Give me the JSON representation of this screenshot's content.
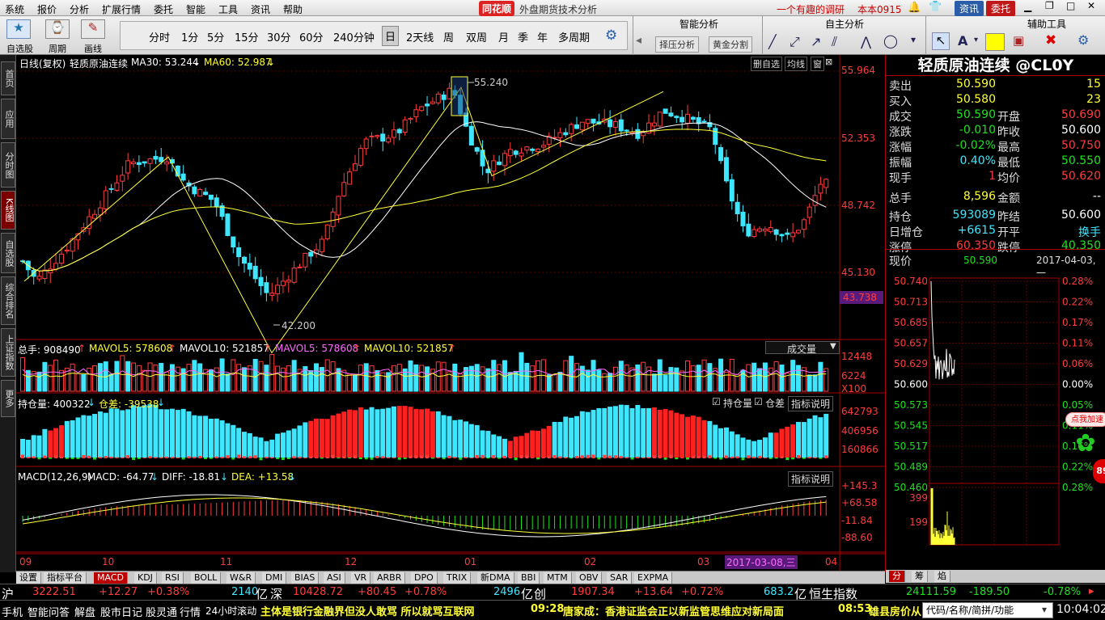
{
  "menu": {
    "items": [
      "系统",
      "报价",
      "分析",
      "扩展行情",
      "委托",
      "智能",
      "工具",
      "资讯",
      "帮助"
    ],
    "brand": "同花顺",
    "app_title": "外盘期货技术分析",
    "news_link": "一个有趣的调研",
    "user": "本本0915",
    "btn_zixun": "资讯",
    "btn_weituo": "委托"
  },
  "toolbar": {
    "tool_labels": [
      "自选股",
      "周期",
      "画线"
    ],
    "periods": [
      "分时",
      "1分",
      "5分",
      "15分",
      "30分",
      "60分",
      "240分钟",
      "日",
      "2天线",
      "周",
      "双周",
      "月",
      "季",
      "年",
      "多周期"
    ],
    "active_period": "日",
    "section_smart": "智能分析",
    "btn_select_analysis": "择压分析",
    "btn_gold_split": "黄金分割",
    "section_autonomous": "自主分析",
    "section_aux": "辅助工具"
  },
  "left_tabs": [
    "首页",
    "应用",
    "分时图",
    "K线图",
    "自选股",
    "综合排名",
    "上证指数",
    "更多"
  ],
  "left_active": "K线图",
  "main_chart": {
    "header": {
      "mode": "日线(复权)",
      "name": "轻质原油连续",
      "ma30_label": "MA30: 53.244",
      "ma60_label": "MA60: 52.987",
      "btn_delete": "删自选",
      "btn_avg": "均线",
      "btn_window": "窗"
    },
    "y_ticks": [
      "55.964",
      "52.353",
      "48.742",
      "45.130"
    ],
    "current_price_tag": "43.738",
    "high_label": "55.240",
    "low_label": "42.200",
    "x_ticks": [
      "09",
      "10",
      "11",
      "12",
      "01",
      "02",
      "03",
      "04"
    ],
    "cursor_date": "2017-03-08,三",
    "colors": {
      "up": "#ff3c3c",
      "down": "#3fe6ff",
      "ma_white": "#ffffff",
      "ma_yellow": "#ffff37",
      "zigzag": "#ffff37"
    }
  },
  "volume_panel": {
    "total_label": "总手: 908490",
    "mavol5_label": "MAVOL5: 578608",
    "mavol10_label": "MAVOL10: 521857",
    "mavol5b_label": "MAVOL5: 578608",
    "mavol10b_label": "MAVOL10: 521857",
    "dropdown": "成交量",
    "y_ticks": [
      "12448",
      "6224",
      "X100"
    ]
  },
  "oi_panel": {
    "oi_label": "持仓量: 400322",
    "diff_label": "仓差: -39538",
    "check_oi": "持仓量",
    "check_diff": "仓差",
    "btn_help": "指标说明",
    "y_ticks": [
      "642793",
      "406956",
      "160866"
    ]
  },
  "macd_panel": {
    "label": "MACD(12,26,9)",
    "macd_label": "MACD: -64.77",
    "diff_label": "DIFF: -18.81",
    "dea_label": "DEA: +13.58",
    "btn_help": "指标说明",
    "y_ticks": [
      "+145.3",
      "+68.58",
      "-11.84",
      "-88.60"
    ]
  },
  "bottom_tabs": [
    "设置",
    "指标平台",
    "MACD",
    "KDJ",
    "RSI",
    "BOLL",
    "W&R",
    "DMI",
    "BIAS",
    "ASI",
    "VR",
    "ARBR",
    "DPO",
    "TRIX",
    "新DMA",
    "BBI",
    "MTM",
    "OBV",
    "SAR",
    "EXPMA"
  ],
  "bottom_active": "MACD",
  "quote": {
    "title": "轻质原油连续 @CL0Y",
    "rows": [
      {
        "l": "卖出",
        "v": "50.590",
        "v_color": "#ffff37",
        "r": "",
        "rv": "15",
        "rv_color": "#ffff37"
      },
      {
        "l": "买入",
        "v": "50.580",
        "v_color": "#ffff37",
        "r": "",
        "rv": "23",
        "rv_color": "#ffff37"
      },
      {
        "l": "成交",
        "v": "50.590",
        "v_color": "#1ee21e",
        "r": "开盘",
        "rv": "50.690",
        "rv_color": "#ff3c3c"
      },
      {
        "l": "涨跌",
        "v": "-0.010",
        "v_color": "#1ee21e",
        "r": "昨收",
        "rv": "50.600",
        "rv_color": "#ffffff"
      },
      {
        "l": "涨幅",
        "v": "-0.02%",
        "v_color": "#1ee21e",
        "r": "最高",
        "rv": "50.750",
        "rv_color": "#ff3c3c"
      },
      {
        "l": "振幅",
        "v": "0.40%",
        "v_color": "#3fe6ff",
        "r": "最低",
        "rv": "50.550",
        "rv_color": "#1ee21e"
      },
      {
        "l": "现手",
        "v": "1",
        "v_color": "#ff3c3c",
        "r": "均价",
        "rv": "50.620",
        "rv_color": "#ff3c3c"
      },
      {
        "l": "总手",
        "v": "8,596",
        "v_color": "#ffff37",
        "r": "金额",
        "rv": "--",
        "rv_color": "#ffffff"
      },
      {
        "l": "持仓",
        "v": "593089",
        "v_color": "#3fe6ff",
        "r": "昨结",
        "rv": "50.600",
        "rv_color": "#ffffff"
      },
      {
        "l": "日增仓",
        "v": "+6615",
        "v_color": "#3fe6ff",
        "r": "开平",
        "rv": "换手",
        "rv_color": "#3fe6ff"
      },
      {
        "l": "涨停",
        "v": "60.350",
        "v_color": "#ff3c3c",
        "r": "跌停",
        "rv": "40.350",
        "rv_color": "#1ee21e"
      }
    ],
    "now_label": "现价",
    "now_value": "50.590",
    "now_date": "2017-04-03,一",
    "intraday_left": [
      "50.740",
      "50.713",
      "50.685",
      "50.657",
      "50.629",
      "50.600",
      "50.573",
      "50.545",
      "50.517",
      "50.489",
      "50.460"
    ],
    "intraday_right": [
      "0.28%",
      "0.22%",
      "0.17%",
      "0.11%",
      "0.06%",
      "0.00%",
      "0.05%",
      "0.11%",
      "0.16%",
      "0.22%",
      "0.28%"
    ],
    "intraday_vol": [
      "399",
      "199"
    ],
    "promo": "点我加速",
    "promo_num": "89",
    "tabs": [
      "分",
      "筹",
      "焰"
    ]
  },
  "status": {
    "sh_label": "沪",
    "sh_val": "3222.51",
    "sh_chg": "+12.27",
    "sh_pct": "+0.38%",
    "sh_amt": "2140",
    "yi": "亿",
    "sz_label": "深",
    "sz_val": "10428.72",
    "sz_chg": "+80.45",
    "sz_pct": "+0.78%",
    "sz_amt": "2496",
    "cy_label": "创",
    "cy_val": "1907.34",
    "cy_chg": "+13.64",
    "cy_pct": "+0.72%",
    "cy_amt": "683.2",
    "hs_label": "恒生指数",
    "hs_val": "24111.59",
    "hs_chg": "-189.50",
    "hs_pct": "-0.78%"
  },
  "status2": {
    "items": [
      "手机",
      "智能问答",
      "解盘",
      "股市日记",
      "股灵通",
      "行情",
      "24小时滚动"
    ],
    "news1": "主体是银行金融界但没人敢骂 所以就骂互联网",
    "news2_time": "09:28",
    "news2": "唐家成：香港证监会正以新监管思维应对新局面",
    "news3_time": "08:53",
    "news3": "雄县房价从",
    "search_placeholder": "代码/名称/简拼/功能",
    "clock": "10:04:02"
  }
}
